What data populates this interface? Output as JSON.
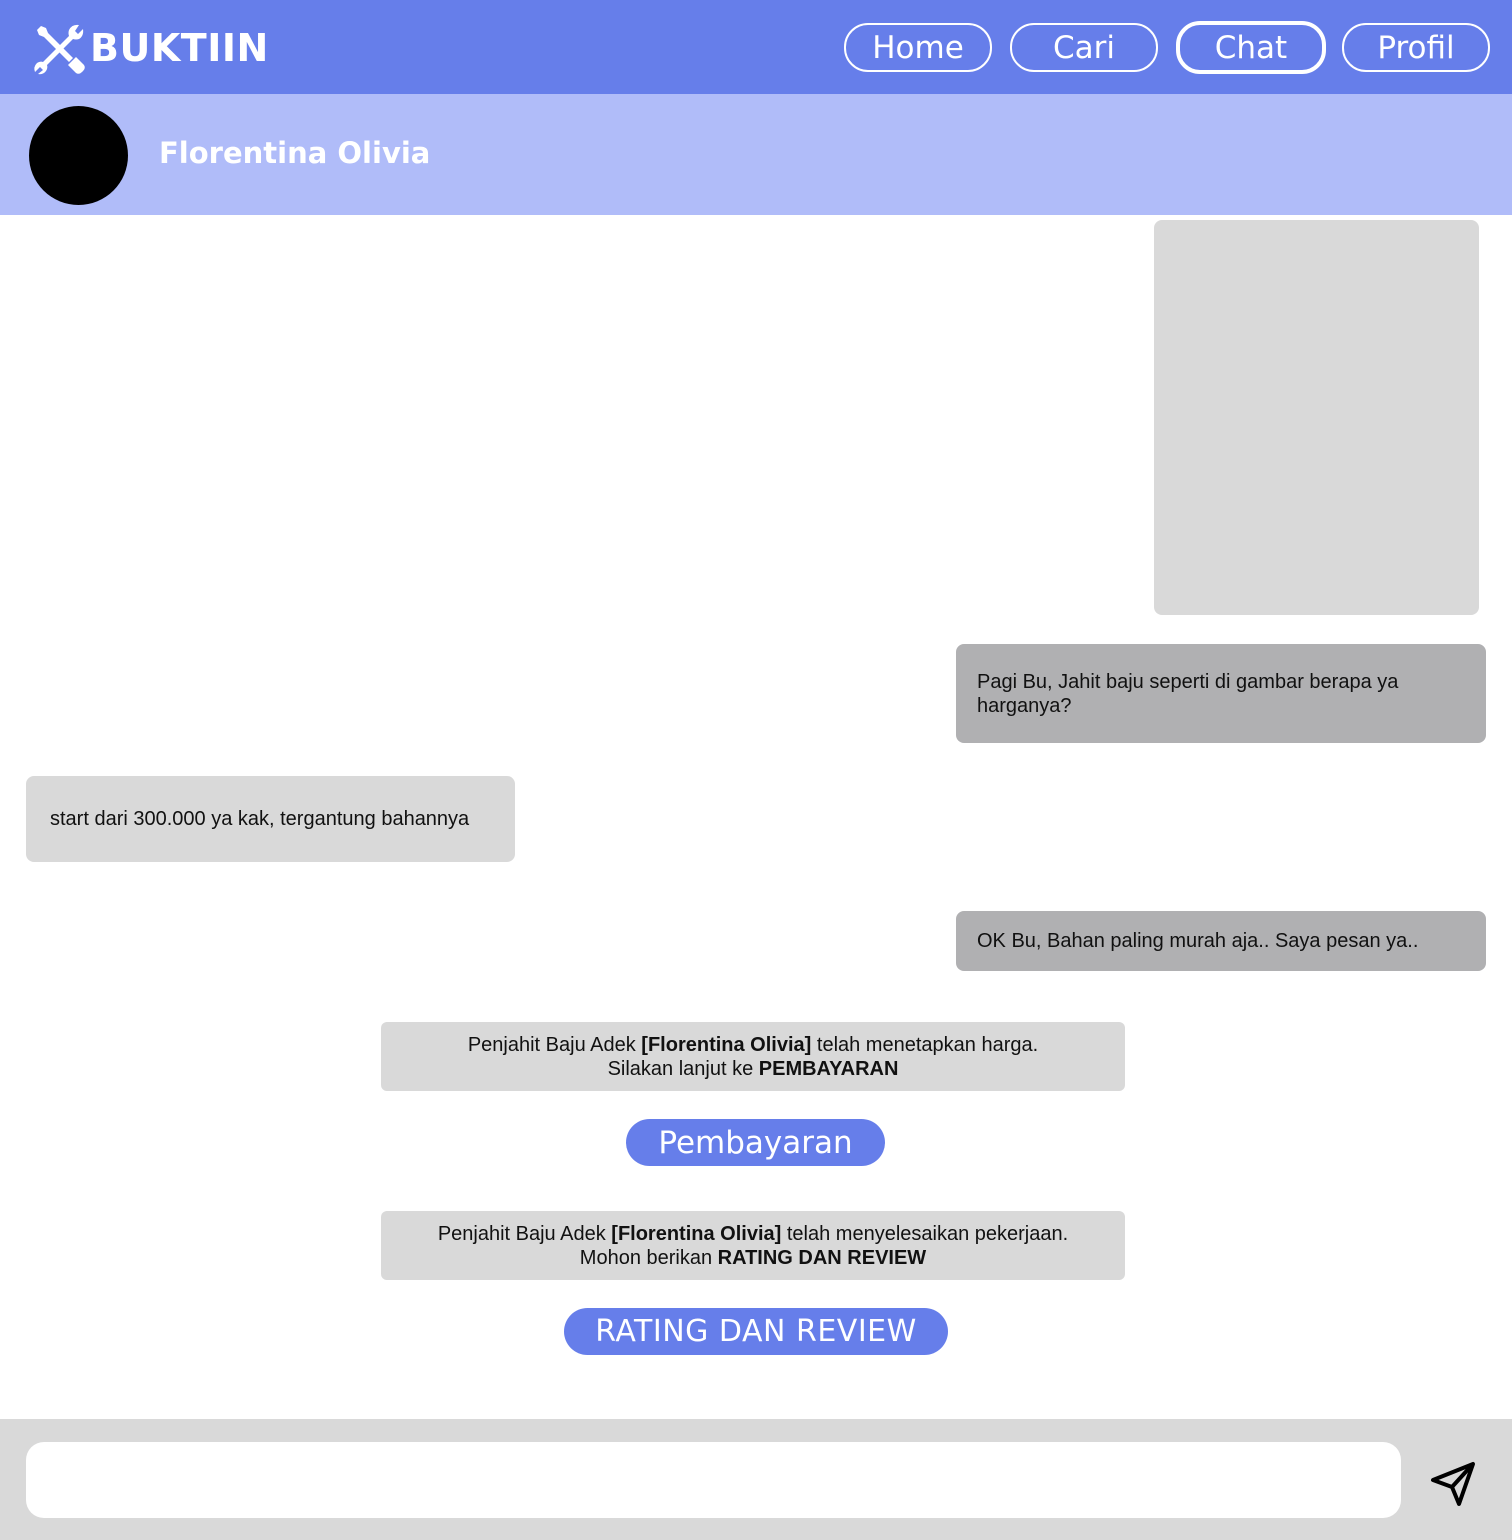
{
  "app": {
    "brand": "BUKTIIN",
    "logo_icon": "tools-icon"
  },
  "nav": {
    "items": [
      {
        "label": "Home",
        "active": false
      },
      {
        "label": "Cari",
        "active": false
      },
      {
        "label": "Chat",
        "active": true
      },
      {
        "label": "Profil",
        "active": false
      }
    ]
  },
  "chat": {
    "contact_name": "Florentina Olivia",
    "messages": [
      {
        "type": "image",
        "direction": "outgoing"
      },
      {
        "type": "text",
        "direction": "outgoing",
        "text": "Pagi Bu, Jahit baju seperti di gambar berapa ya harganya?"
      },
      {
        "type": "text",
        "direction": "incoming",
        "text": "start dari 300.000 ya kak, tergantung bahannya"
      },
      {
        "type": "text",
        "direction": "outgoing",
        "text": "OK Bu, Bahan paling murah aja.. Saya pesan ya.."
      }
    ],
    "system": [
      {
        "line1_pre": "Penjahit Baju Adek ",
        "line1_bold": "[Florentina Olivia]",
        "line1_post": " telah menetapkan harga.",
        "line2_pre": "Silakan lanjut ke ",
        "line2_bold": "PEMBAYARAN",
        "button": "Pembayaran"
      },
      {
        "line1_pre": "Penjahit Baju Adek ",
        "line1_bold": "[Florentina Olivia]",
        "line1_post": " telah menyelesaikan pekerjaan.",
        "line2_pre": "Mohon berikan ",
        "line2_bold": "RATING DAN REVIEW",
        "button": "RATING DAN REVIEW"
      }
    ]
  },
  "composer": {
    "value": "",
    "send_icon": "send-icon"
  },
  "colors": {
    "primary": "#667eea",
    "header_light": "#b0bcf9",
    "bubble_incoming": "#d9d9d9",
    "bubble_outgoing": "#b0b0b2",
    "composer_bg": "#d9d9d9"
  }
}
